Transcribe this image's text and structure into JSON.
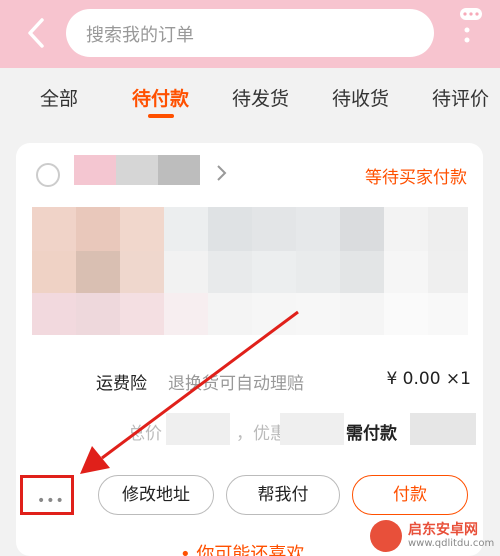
{
  "header": {
    "search_placeholder": "搜索我的订单"
  },
  "tabs": [
    {
      "label": "全部",
      "active": false
    },
    {
      "label": "待付款",
      "active": true
    },
    {
      "label": "待发货",
      "active": false
    },
    {
      "label": "待收货",
      "active": false
    },
    {
      "label": "待评价",
      "active": false
    }
  ],
  "order": {
    "status": "等待买家付款",
    "insurance": {
      "label": "运费险",
      "desc": "退换货可自动理赔",
      "price": "¥ 0.00 ×1"
    },
    "total_label": "总价",
    "discount_label": "，优惠",
    "need_pay_label": "需付款",
    "more_dots": "•••",
    "buttons": {
      "modify_address": "修改地址",
      "pay_for_me": "帮我付",
      "pay": "付款"
    }
  },
  "bottom_text": "• 你可能还喜欢",
  "watermark": {
    "line1": "启东安卓网",
    "line2": "www.qdlitdu.com"
  },
  "colors": {
    "accent": "#ff5000",
    "header_bg": "#f7c4cf",
    "highlight_box": "#e0201a"
  }
}
